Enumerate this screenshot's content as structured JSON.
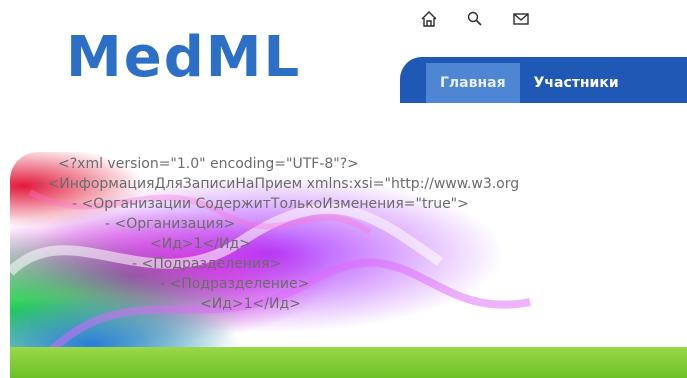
{
  "brand": {
    "logo_text": "MedML"
  },
  "top_icons": [
    {
      "name": "home-icon"
    },
    {
      "name": "search-icon"
    },
    {
      "name": "mail-icon"
    }
  ],
  "nav": {
    "tabs": [
      {
        "label": "Главная",
        "active": true
      },
      {
        "label": "Участники",
        "active": false
      }
    ]
  },
  "hero": {
    "xml_lines": [
      "<?xml version=\"1.0\" encoding=\"UTF-8\"?>",
      "- <ИнформацияДляЗаписиНаПрием xmlns:xsi=\"http://www.w3.org",
      "- <Организации СодержитТолькоИзменения=\"true\">",
      "- <Организация>",
      "<Ид>1</Ид>",
      "- <Подразделения>",
      "- <Подразделение>",
      "<Ид>1</Ид>"
    ]
  },
  "colors": {
    "brand_blue": "#2b6fc7",
    "nav_blue": "#1f59b5",
    "nav_active": "#4f86d4",
    "band_green": "#7cc832"
  }
}
